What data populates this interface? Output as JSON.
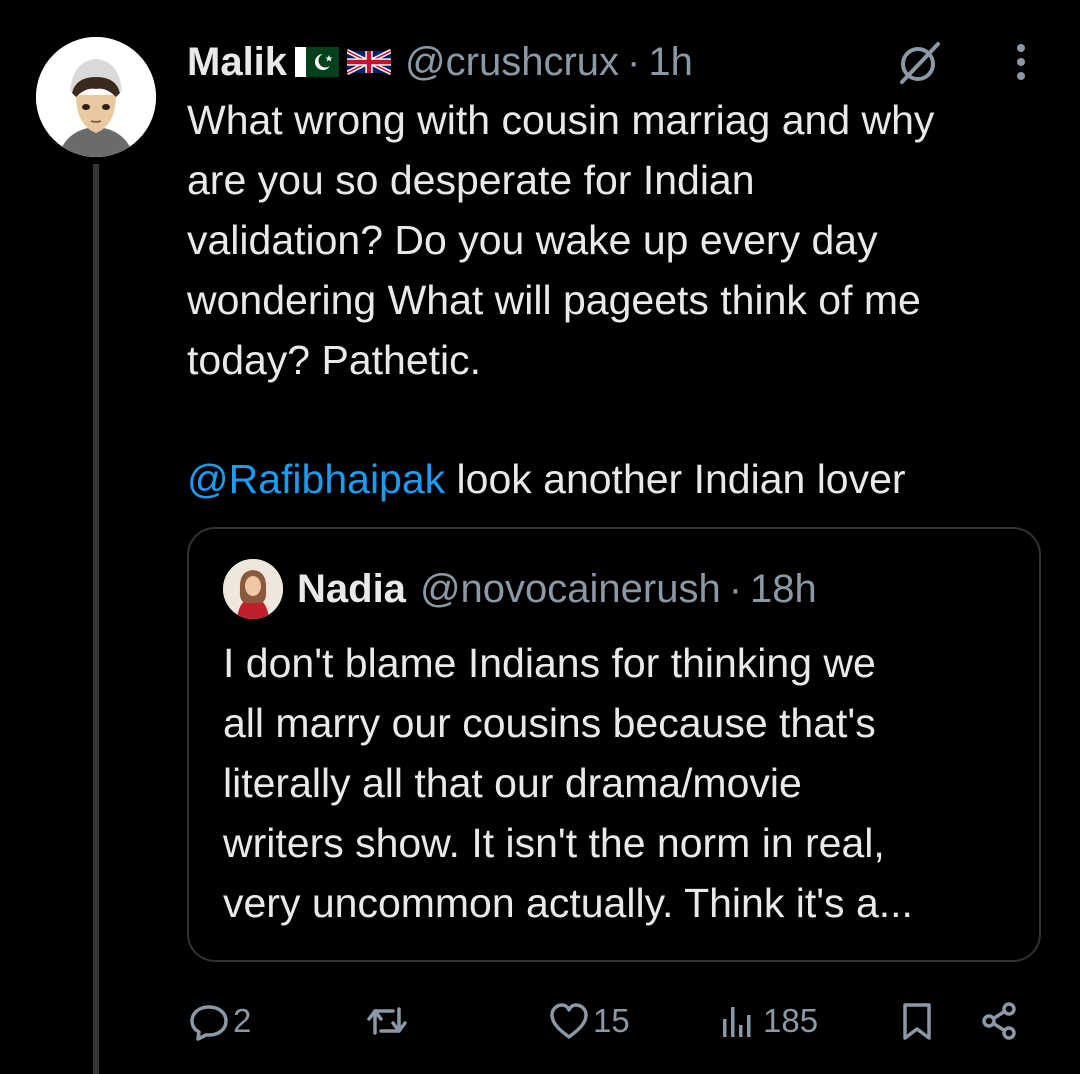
{
  "tweet": {
    "author_name": "Malik",
    "author_flags": [
      "pakistan-flag-icon",
      "uk-flag-icon"
    ],
    "handle": "@crushcrux",
    "separator": "·",
    "time": "1h",
    "body": "What wrong with cousin marriag and why\nare you so desperate for Indian\nvalidation? Do you wake up every day\nwondering What will pageets think of me\ntoday? Pathetic.",
    "mention": "@Rafibhaipak",
    "mention_suffix": " look another Indian lover"
  },
  "quoted_tweet": {
    "author_name": "Nadia",
    "handle": "@novocainerush",
    "separator": "·",
    "time": "18h",
    "body": "I don't blame Indians for thinking we\nall marry our cousins because that's\nliterally all that our drama/movie\nwriters show. It isn't the norm in real,\nvery uncommon actually. Think it's a..."
  },
  "actions": {
    "replies": "2",
    "reposts": "",
    "likes": "15",
    "views": "185"
  },
  "colors": {
    "background": "#000000",
    "text": "#e7e9ea",
    "muted": "#8b98a5",
    "link": "#1d9bf0",
    "border": "#2f3336"
  }
}
